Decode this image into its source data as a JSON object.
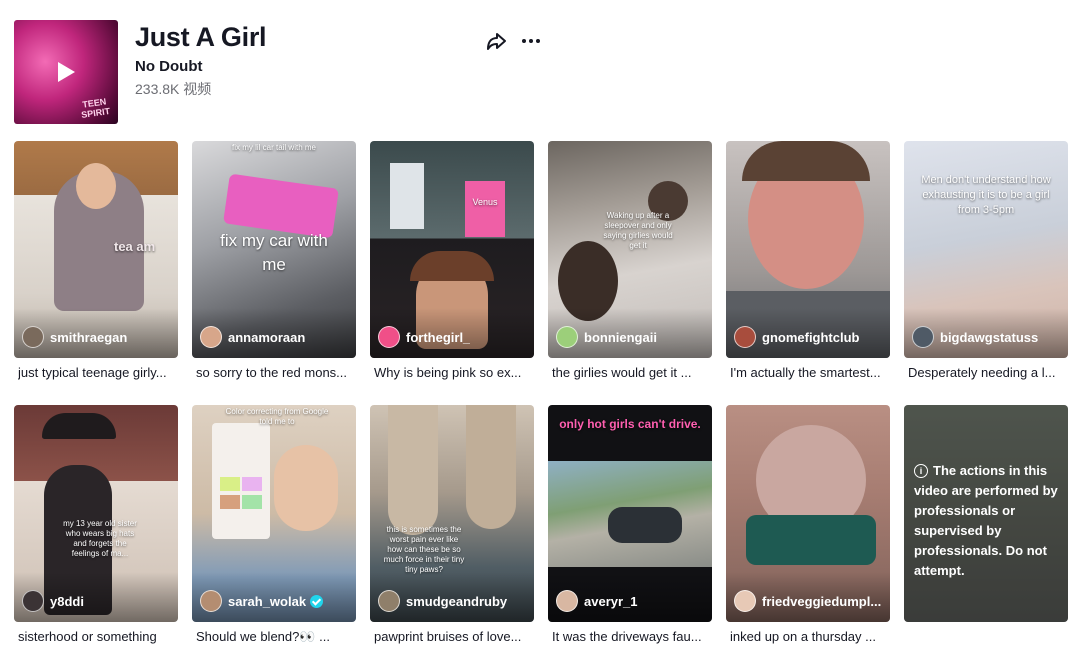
{
  "sound": {
    "title": "Just A Girl",
    "artist": "No Doubt",
    "video_count": "233.8K 视频",
    "cover_text": "TEEN SPIRIT"
  },
  "icons": {
    "share": "share-icon",
    "more": "more-icon",
    "play": "play-icon",
    "verified": "verified-icon",
    "info": "info-icon"
  },
  "videos": [
    {
      "user": "smithraegan",
      "caption": "just typical teenage girly...",
      "overlay": "",
      "shirt": "tea am"
    },
    {
      "user": "annamoraan",
      "caption": "so sorry to the red mons...",
      "overlay": "fix my car with me",
      "top": "fix my lil car tail with me"
    },
    {
      "user": "forthegirl_",
      "caption": "Why is being pink so ex...",
      "overlay": "",
      "tag": "Venus"
    },
    {
      "user": "bonniengaii",
      "caption": "the girlies would get it ...",
      "overlay": "Waking up after a sleepover and only saying girlies would get it"
    },
    {
      "user": "gnomefightclub",
      "caption": "I'm actually the smartest...",
      "overlay": ""
    },
    {
      "user": "bigdawgstatuss",
      "caption": "Desperately needing a l...",
      "overlay": "Men don't understand how exhausting it is to be a girl from 3-5pm"
    },
    {
      "user": "y8ddi",
      "caption": "sisterhood or something",
      "overlay": "my 13 year old sister who wears big hats and forgets the feelings of ma..."
    },
    {
      "user": "sarah_wolak",
      "caption": "Should we blend?👀 ...",
      "overlay": "Color correcting from Google told me to",
      "verified": true
    },
    {
      "user": "smudgeandruby",
      "caption": "pawprint bruises of love...",
      "overlay": "this is sometimes the worst pain ever like how can these be so much force in their tiny tiny paws?"
    },
    {
      "user": "averyr_1",
      "caption": "It was the driveways fau...",
      "overlay": "only hot girls can't drive."
    },
    {
      "user": "friedveggiedumpl...",
      "caption": "inked up on a thursday ...",
      "overlay": ""
    },
    {
      "user": "",
      "caption": "",
      "overlay": "",
      "warning": "The actions in this video are performed by professionals or supervised by professionals. Do not attempt."
    }
  ],
  "colors": {
    "accent": "#fe2c55",
    "text": "#161823",
    "muted": "#6c6d73"
  }
}
